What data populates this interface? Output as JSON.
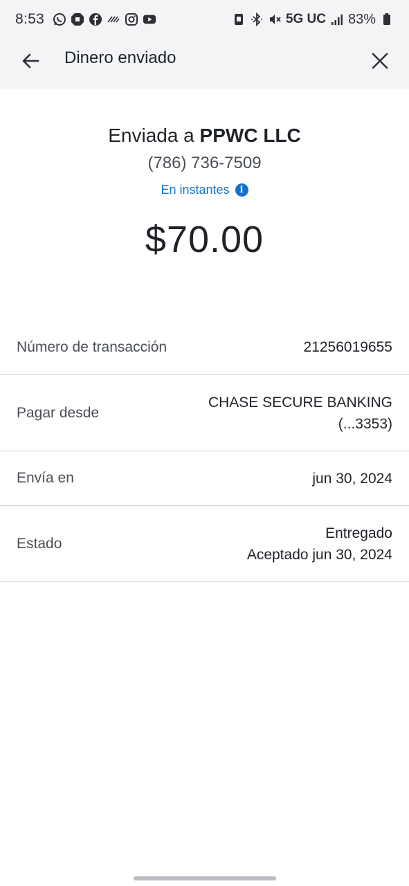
{
  "status_bar": {
    "time": "8:53",
    "network": "5G UC",
    "battery": "83%",
    "left_icons": [
      "whatsapp-icon",
      "chase-icon",
      "facebook-icon",
      "wave-icon",
      "instagram-icon",
      "youtube-icon"
    ],
    "right_icons": [
      "nfc-icon",
      "bluetooth-icon",
      "mute-icon",
      "signal-icon",
      "battery-icon"
    ]
  },
  "header": {
    "title": "Dinero enviado",
    "back_icon": "back-arrow-icon",
    "close_icon": "close-icon"
  },
  "summary": {
    "sent_prefix": "Enviada a",
    "recipient": "PPWC LLC",
    "phone": "(786) 736-7509",
    "speed": "En instantes",
    "amount": "$70.00"
  },
  "details": {
    "transaction_label": "Número de transacción",
    "transaction_value": "21256019655",
    "pay_from_label": "Pagar desde",
    "pay_from_line1": "CHASE SECURE BANKING",
    "pay_from_line2": "(...3353)",
    "send_on_label": "Envía en",
    "send_on_value": "jun 30, 2024",
    "status_label": "Estado",
    "status_line1": "Entregado",
    "status_line2": "Aceptado jun 30, 2024"
  },
  "colors": {
    "accent": "#1672c9",
    "header_bg": "#f3f4f6",
    "divider": "#cfd3d8"
  }
}
